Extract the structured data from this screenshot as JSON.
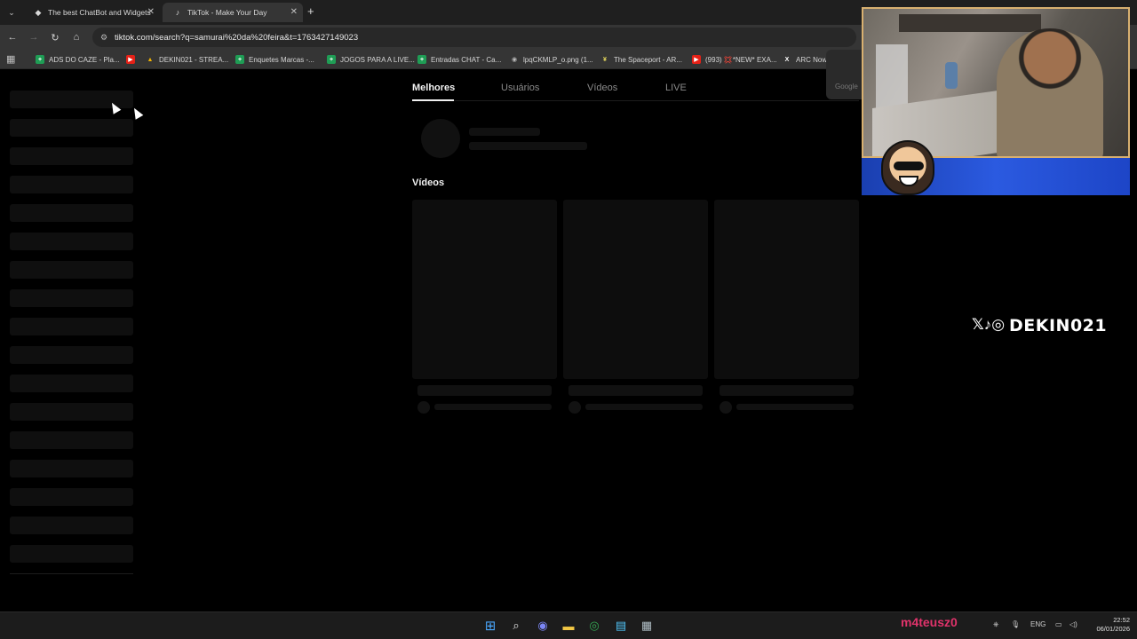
{
  "browser": {
    "tabs": [
      {
        "title": "The best ChatBot and Widgets",
        "favicon": "streamelements-icon",
        "active": false
      },
      {
        "title": "TikTok - Make Your Day",
        "favicon": "tiktok-icon",
        "active": true
      }
    ],
    "url": "tiktok.com/search?q=samurai%20da%20feira&t=1763427149023",
    "bookmarks": [
      {
        "label": "ADS DO CAZE - Pla...",
        "icon": "sheets-icon"
      },
      {
        "label": "",
        "icon": "youtube-icon"
      },
      {
        "label": "DEKIN021 - STREA...",
        "icon": "drive-icon"
      },
      {
        "label": "Enquetes Marcas -...",
        "icon": "sheets-icon"
      },
      {
        "label": "JOGOS PARA A LIVE...",
        "icon": "sheets-icon"
      },
      {
        "label": "Entradas CHAT - Ca...",
        "icon": "sheets-icon"
      },
      {
        "label": "lpqCKMLP_o.png (1...",
        "icon": "globe-icon"
      },
      {
        "label": "The Spaceport - AR...",
        "icon": "spaceport-icon"
      },
      {
        "label": "(993) 💢*NEW* EXA...",
        "icon": "youtube-icon"
      },
      {
        "label": "ARC Now",
        "icon": "x-icon"
      }
    ]
  },
  "search_page": {
    "tabs": [
      "Melhores",
      "Usuários",
      "Vídeos",
      "LIVE"
    ],
    "active_tab": "Melhores",
    "section_title": "Vídeos"
  },
  "popup": {
    "label": "Google"
  },
  "overlay": {
    "handle": "DEKIN021",
    "social": "𝕏♪◎"
  },
  "taskbar": {
    "overlay_name": "m4teusz0",
    "language": "ENG",
    "time": "22:52",
    "date": "06/01/2026"
  },
  "colors": {
    "accent_overlay_name": "#e0336b",
    "banner_blue": "#2b5ae0",
    "page_bg": "#000000"
  }
}
